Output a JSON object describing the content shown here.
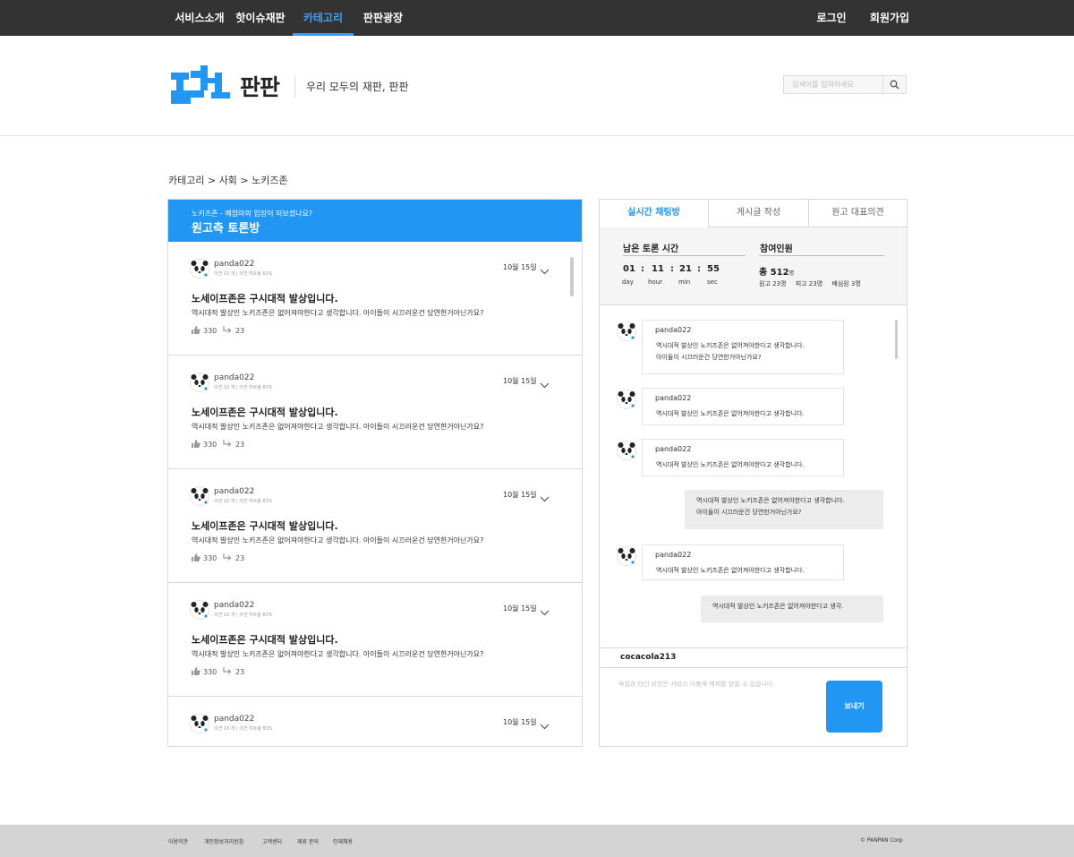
{
  "nav": {
    "items": [
      "서비스소개",
      "핫이슈재판",
      "카테고리",
      "판판광장"
    ],
    "active_index": 2,
    "login": "로그인",
    "signup": "회원가입"
  },
  "header": {
    "logo_text": "판판",
    "tagline": "우리 모두의 재판, 판판",
    "search_placeholder": "검색어를 입력하세요",
    "search_icon": "search-icon"
  },
  "breadcrumb": "카테고리 > 사회 > 노키즈존",
  "room": {
    "subtitle": "노키즈존 - 예엄마의 입장이 되보셨나요?",
    "title": "원고측 토론방"
  },
  "posts": [
    {
      "author": "panda022",
      "meta": "의견 10 개 | 의견 히트율 83%",
      "date": "10월 15일",
      "title": "노세이프존은 구시대적 발상입니다.",
      "body": "역시대적 발상인 노키즈존은 없어져야한다고 생각합니다. 아이들이 시끄러운건 당연한거아닌가요?",
      "likes": "330",
      "comments": "23"
    },
    {
      "author": "panda022",
      "meta": "의견 10 개 | 의견 히트율 83%",
      "date": "10월 15일",
      "title": "노세이프존은 구시대적 발상입니다.",
      "body": "역시대적 발상인 노키즈존은 없어져야한다고 생각합니다. 아이들이 시끄러운건 당연한거아닌가요?",
      "likes": "330",
      "comments": "23"
    },
    {
      "author": "panda022",
      "meta": "의견 10 개 | 의견 히트율 83%",
      "date": "10월 15일",
      "title": "노세이프존은 구시대적 발상입니다.",
      "body": "역시대적 발상인 노키즈존은 없어져야한다고 생각합니다. 아이들이 시끄러운건 당연한거아닌가요?",
      "likes": "330",
      "comments": "23"
    },
    {
      "author": "panda022",
      "meta": "의견 10 개 | 의견 히트율 83%",
      "date": "10월 15일",
      "title": "노세이프존은 구시대적 발상입니다.",
      "body": "역시대적 발상인 노키즈존은 없어져야한다고 생각합니다. 아이들이 시끄러운건 당연한거아닌가요?",
      "likes": "330",
      "comments": "23"
    },
    {
      "author": "panda022",
      "meta": "의견 10 개 | 의견 히트율 83%",
      "date": "10월 15일",
      "title": "노세이프존은 구시대적 발상입니다.",
      "body": "",
      "likes": "",
      "comments": ""
    }
  ],
  "tabs": [
    "실시간 채팅방",
    "게시글 작성",
    "원고 대표의견"
  ],
  "active_tab": 0,
  "info": {
    "time_label": "남은 토론 시간",
    "people_label": "참여인원",
    "timer": {
      "day": "01",
      "hour": "11",
      "min": "21",
      "sec": "55"
    },
    "units": {
      "day": "day",
      "hour": "hour",
      "min": "min",
      "sec": "sec"
    },
    "total": "총 512",
    "total_unit": "명",
    "breakdown": [
      "원고 23명",
      "피고 23명",
      "배심원 3명"
    ]
  },
  "chat": [
    {
      "type": "other",
      "author": "panda022",
      "lines": [
        "역시대적 발상인 노키즈존은 없어져야한다고 생각합니다.",
        "아이들이 시끄러운건 당연한거아닌가요?"
      ]
    },
    {
      "type": "other",
      "author": "panda022",
      "lines": [
        "역시대적 발상인 노키즈존은 없어져야한다고 생각합니다."
      ]
    },
    {
      "type": "other",
      "author": "panda022",
      "lines": [
        "역시대적 발상인 노키즈존은 없어져야한다고 생각합니다."
      ]
    },
    {
      "type": "mine",
      "lines": [
        "역시대적 발상인 노키즈존은 없어져야한다고 생각합니다.",
        "아이들이 시끄러운건 당연한거아닌가요?"
      ]
    },
    {
      "type": "other",
      "author": "panda022",
      "lines": [
        "역시대적 발상인 노키즈존은 없어져야한다고 생각합니다."
      ]
    },
    {
      "type": "mine",
      "lines": [
        "역시대적 발상인 노키즈존은 없어져야한다고 생각."
      ]
    }
  ],
  "me": "cocacola213",
  "compose": {
    "placeholder": "욕설과 타인 비방은 서비스 이용에 제재를 받을 수 있습니다.",
    "send": "보내기"
  },
  "footer": {
    "links": [
      "이용약관",
      "개인정보처리방침",
      "고객센터",
      "제휴 문의",
      "인재채용"
    ],
    "copyright": "© PANPAN Corp"
  },
  "colors": {
    "accent": "#2196f3",
    "nav_bg": "#333333",
    "footer_bg": "#d4d4d4"
  }
}
